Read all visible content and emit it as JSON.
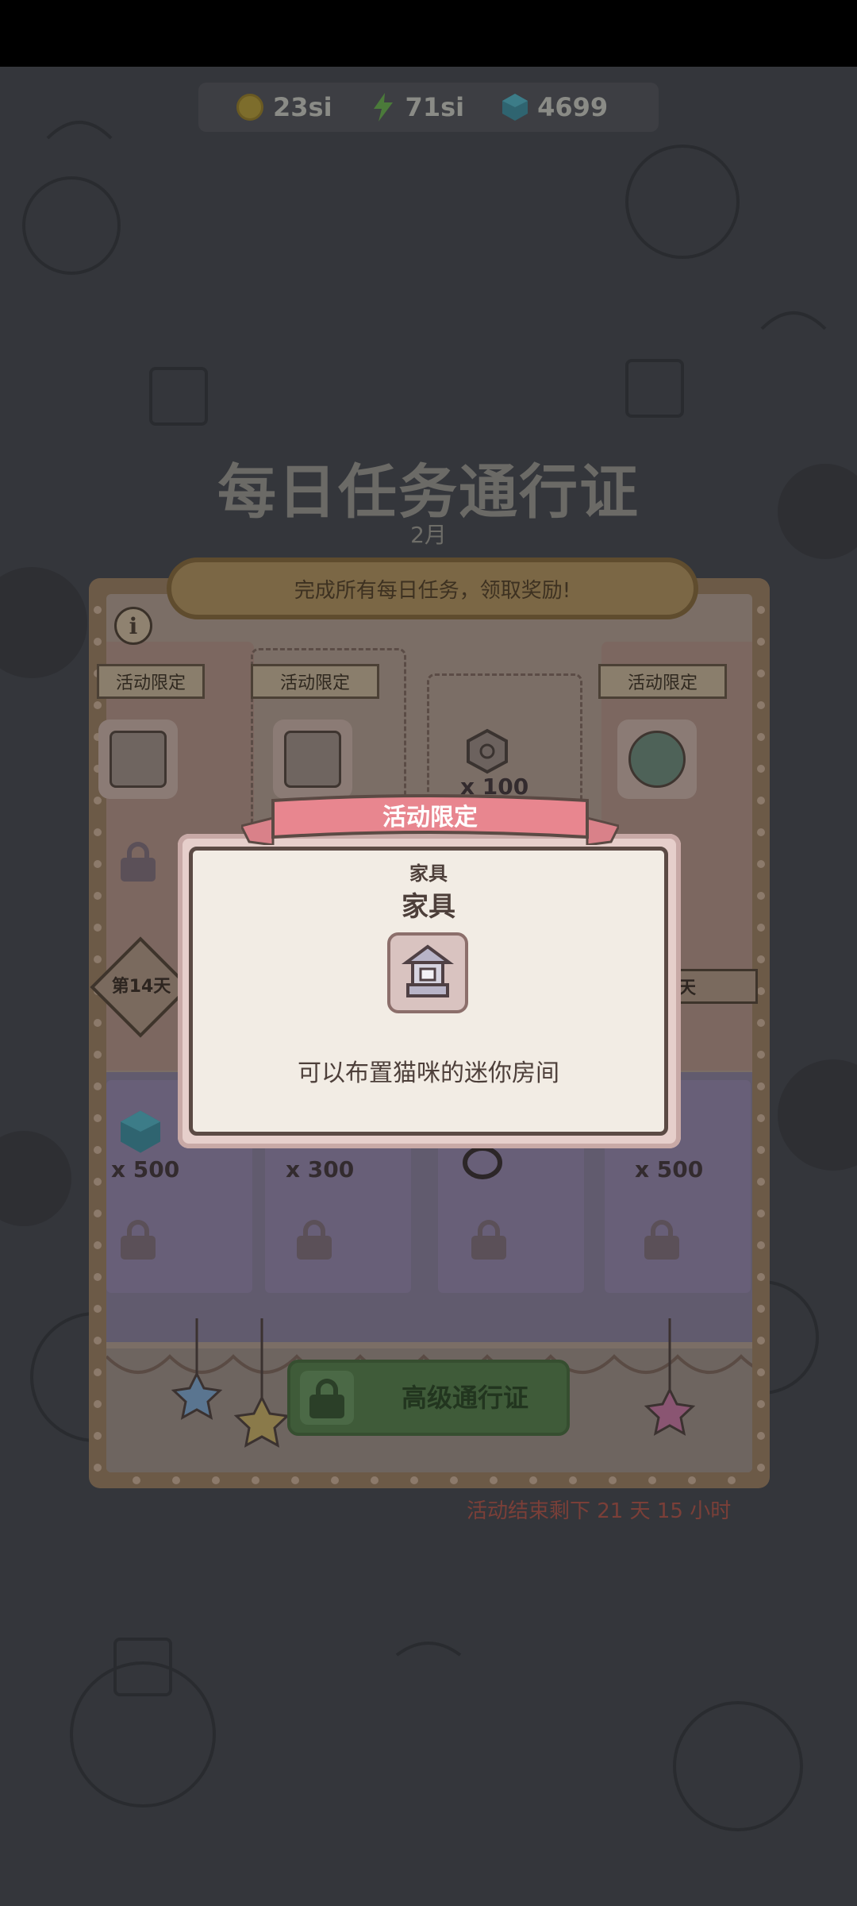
{
  "status_bar": {},
  "resources": {
    "coins": "23si",
    "energy": "71si",
    "gems": "4699"
  },
  "header": {
    "title": "每日任务通行证",
    "month": "2月"
  },
  "banner": {
    "instruction": "完成所有每日任务，领取奖励!"
  },
  "free_track": {
    "tag_label": "活动限定",
    "columns": [
      {
        "tag": "活动限定",
        "qty": ""
      },
      {
        "tag": "活动限定",
        "qty": ""
      },
      {
        "tag": "",
        "qty": "x 100"
      },
      {
        "tag": "活动限定",
        "qty": ""
      }
    ]
  },
  "day_marker": {
    "left_label": "第14天",
    "right_label": "天"
  },
  "premium_track": {
    "columns": [
      {
        "qty": "x 500"
      },
      {
        "qty": "x 300"
      },
      {
        "qty": ""
      },
      {
        "qty": "x 500"
      }
    ]
  },
  "premium_button": {
    "label": "高级通行证"
  },
  "countdown": {
    "text": "活动结束剩下  21 天 15 小时"
  },
  "dialog": {
    "ribbon": "活动限定",
    "category": "家具",
    "name": "家具",
    "description": "可以布置猫咪的迷你房间"
  },
  "colors": {
    "accent_pink": "#e8868f",
    "premium_green": "#3f5b39",
    "countdown_red": "#7b3f38"
  }
}
